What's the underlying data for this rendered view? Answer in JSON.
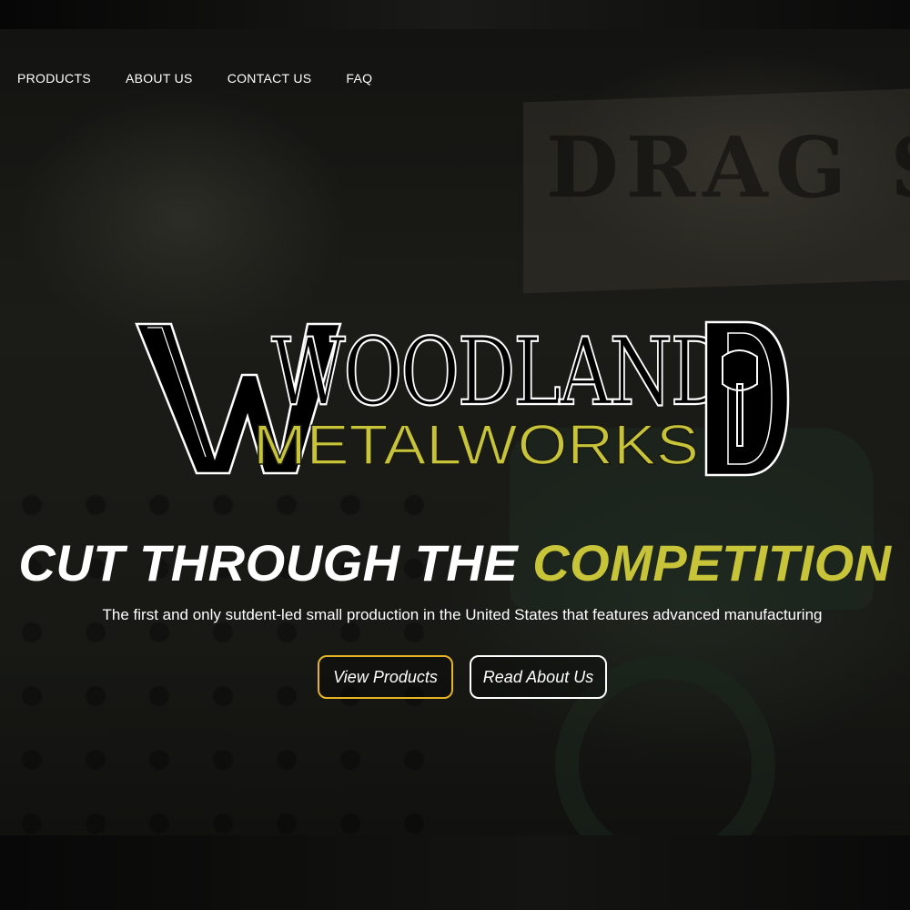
{
  "nav": {
    "items": [
      {
        "label": "PRODUCTS"
      },
      {
        "label": "ABOUT US"
      },
      {
        "label": "CONTACT US"
      },
      {
        "label": "FAQ"
      }
    ]
  },
  "logo": {
    "line1": "WOODLAND",
    "line2": "METALWORKS"
  },
  "background": {
    "sign_text": "DRAG S"
  },
  "hero": {
    "headline_main": "CUT THROUGH THE ",
    "headline_accent": "COMPETITION",
    "subtitle": "The first and only sutdent-led small production in the United States that features advanced manufacturing",
    "buttons": {
      "view_products": "View Products",
      "read_about": "Read About Us"
    }
  },
  "colors": {
    "accent": "#c8c43a",
    "button_products_border": "#e6b424",
    "text": "#ffffff"
  }
}
